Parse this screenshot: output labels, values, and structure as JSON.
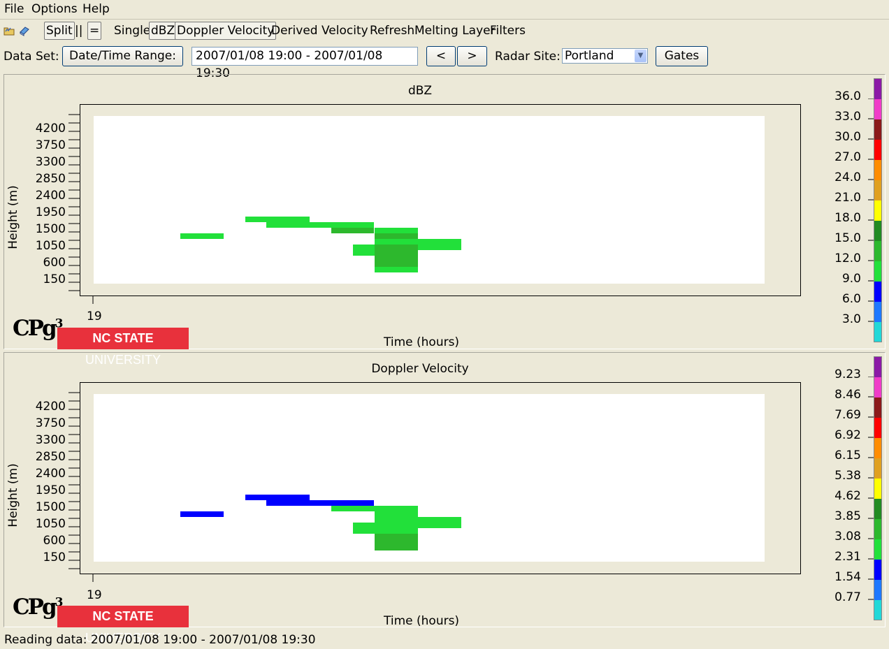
{
  "menubar": {
    "file": "File",
    "options": "Options",
    "help": "Help"
  },
  "toolbar": {
    "split": "Split",
    "parallel": "||",
    "equals": "=",
    "single": "Single",
    "dbz": "dBZ",
    "doppler": "Doppler Velocity",
    "derived": "Derived Velocity",
    "refresh": "Refresh",
    "melting": "Melting Layer",
    "filters": "Filters",
    "icons": [
      "open-folder-icon",
      "book-icon"
    ]
  },
  "dataset": {
    "label": "Data Set:",
    "range_button": "Date/Time Range:",
    "range_value": "2007/01/08 19:00 - 2007/01/08 19:30",
    "prev": "<",
    "next": ">",
    "radar_label": "Radar Site:",
    "radar_value": "Portland",
    "gates": "Gates"
  },
  "panels": [
    {
      "title": "dBZ",
      "ylabel": "Height (m)",
      "xlabel": "Time (hours)",
      "yticks": [
        "4200",
        "3750",
        "3300",
        "2850",
        "2400",
        "1950",
        "1500",
        "1050",
        "600",
        "150"
      ],
      "xtick": "19",
      "colorbar_labels": [
        "36.0",
        "33.0",
        "30.0",
        "27.0",
        "24.0",
        "21.0",
        "18.0",
        "15.0",
        "12.0",
        "9.0",
        "6.0",
        "3.0"
      ]
    },
    {
      "title": "Doppler Velocity",
      "ylabel": "Height (m)",
      "xlabel": "Time (hours)",
      "yticks": [
        "4200",
        "3750",
        "3300",
        "2850",
        "2400",
        "1950",
        "1500",
        "1050",
        "600",
        "150"
      ],
      "xtick": "19",
      "colorbar_labels": [
        "9.23",
        "8.46",
        "7.69",
        "6.92",
        "6.15",
        "5.38",
        "4.62",
        "3.85",
        "3.08",
        "2.31",
        "1.54",
        "0.77"
      ]
    }
  ],
  "colorbar_colors": [
    "#8b1aa6",
    "#f03cc8",
    "#8b1a1a",
    "#ff0000",
    "#ff8c00",
    "#e0a020",
    "#ffff00",
    "#228b22",
    "#2db82d",
    "#22e03a",
    "#0000ff",
    "#1e78ff",
    "#22d8d8"
  ],
  "logo": {
    "cpg": "CPg",
    "cpg_sup": "3",
    "ncsu_bold": "NC STATE",
    "ncsu_rest": "UNIVERSITY"
  },
  "status": "Reading data: 2007/01/08 19:00 - 2007/01/08 19:30"
}
